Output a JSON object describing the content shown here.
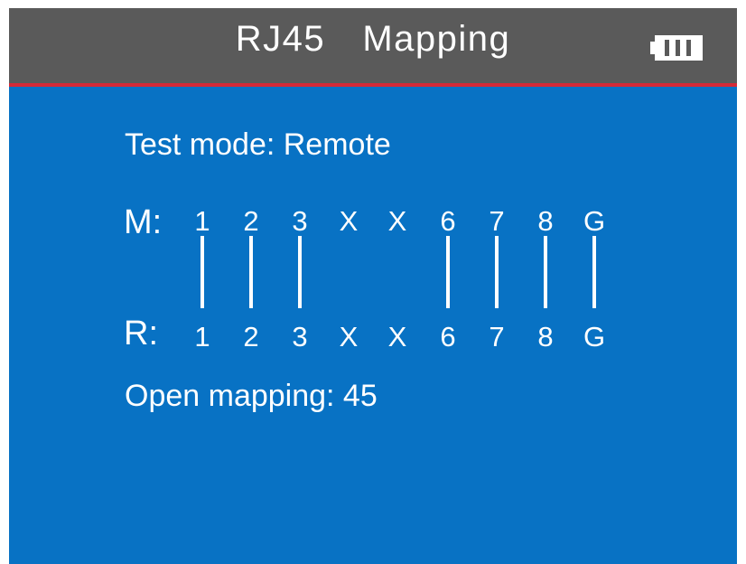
{
  "header": {
    "title": "RJ45  Mapping",
    "battery_icon": "battery-full-icon",
    "battery_level": 1.0,
    "background_color": "#5a5a5a",
    "rule_color": "#d42a37"
  },
  "screen": {
    "background_color": "#0872c4",
    "test_mode": "Test mode: Remote",
    "open_mapping": "Open mapping: 45"
  },
  "mapping": {
    "main_label": "M:",
    "remote_label": "R:",
    "main_pins": [
      "1",
      "2",
      "3",
      "X",
      "X",
      "6",
      "7",
      "8",
      "G"
    ],
    "remote_pins": [
      "1",
      "2",
      "3",
      "X",
      "X",
      "6",
      "7",
      "8",
      "G"
    ],
    "connected": [
      true,
      true,
      true,
      false,
      false,
      true,
      true,
      true,
      true
    ]
  }
}
